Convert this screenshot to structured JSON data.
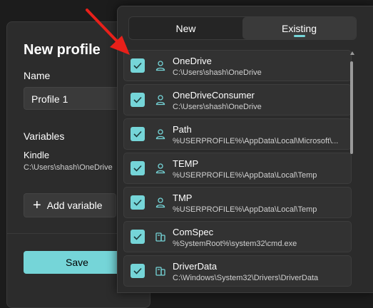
{
  "background_dialog": {
    "title": "New profile",
    "name_label": "Name",
    "name_value": "Profile 1",
    "variables_label": "Variables",
    "variable": {
      "name": "Kindle",
      "value": "C:\\Users\\shash\\OneDrive"
    },
    "add_variable_label": "Add variable",
    "save_label": "Save"
  },
  "flyout": {
    "tabs": [
      {
        "label": "New",
        "active": false
      },
      {
        "label": "Existing",
        "active": true
      }
    ],
    "items": [
      {
        "name": "OneDrive",
        "value": "C:\\Users\\shash\\OneDrive",
        "checked": true,
        "icon": "user-icon"
      },
      {
        "name": "OneDriveConsumer",
        "value": "C:\\Users\\shash\\OneDrive",
        "checked": true,
        "icon": "user-icon"
      },
      {
        "name": "Path",
        "value": "%USERPROFILE%\\AppData\\Local\\Microsoft\\...",
        "checked": true,
        "icon": "user-icon"
      },
      {
        "name": "TEMP",
        "value": "%USERPROFILE%\\AppData\\Local\\Temp",
        "checked": true,
        "icon": "user-icon"
      },
      {
        "name": "TMP",
        "value": "%USERPROFILE%\\AppData\\Local\\Temp",
        "checked": true,
        "icon": "user-icon"
      },
      {
        "name": "ComSpec",
        "value": "%SystemRoot%\\system32\\cmd.exe",
        "checked": true,
        "icon": "system-icon"
      },
      {
        "name": "DriverData",
        "value": "C:\\Windows\\System32\\Drivers\\DriverData",
        "checked": true,
        "icon": "system-icon"
      }
    ]
  },
  "colors": {
    "accent": "#75d5d8",
    "arrow": "#e8201a"
  }
}
